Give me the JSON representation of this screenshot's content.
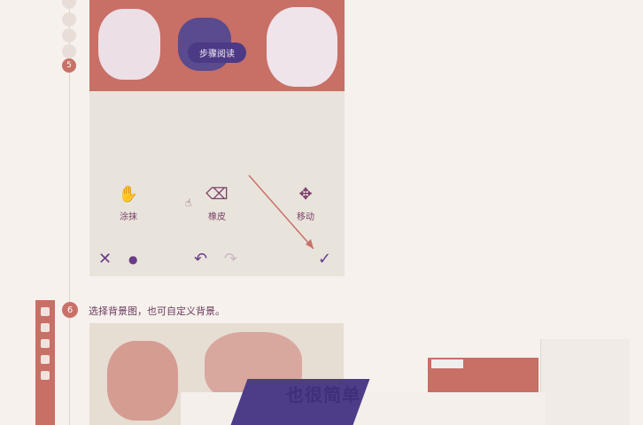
{
  "steps": {
    "active_step": "5",
    "step6_number": "6",
    "step6_label": "选择背景图，也可自定义背景。"
  },
  "editor": {
    "pill_label": "步骤阅读",
    "tools": [
      {
        "label": "涂抹",
        "icon": "smudge-icon"
      },
      {
        "label": "橡皮",
        "icon": "eraser-icon"
      },
      {
        "label": "移动",
        "icon": "move-icon"
      }
    ],
    "bottom_bar": {
      "close_icon": "close-icon",
      "help_icon": "help-icon",
      "undo_icon": "undo-icon",
      "redo_icon": "redo-icon",
      "confirm_icon": "check-icon"
    }
  },
  "banner": {
    "text": "也很简单"
  },
  "colors": {
    "accent": "#c97168",
    "purple": "#4d3d89",
    "bg": "#f6f1ec"
  }
}
